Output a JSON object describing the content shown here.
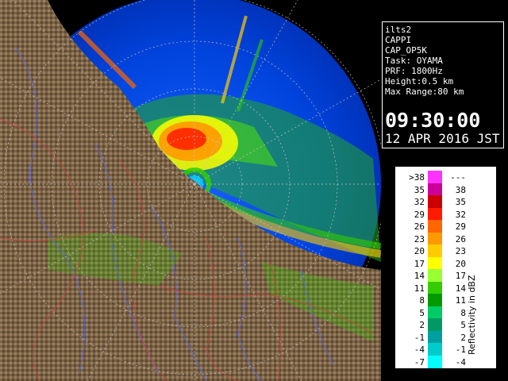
{
  "info": {
    "lines": [
      "ilts2",
      "CAPPI",
      "CAP_OP5K",
      "Task: OYAMA",
      "PRF: 1800Hz",
      "Height:0.5 km",
      "Max Range:80 km"
    ],
    "time": "09:30:00",
    "date": "12 APR 2016 JST"
  },
  "legend": {
    "title": "Reflectivity in dBZ",
    "rows": [
      {
        "low": ">38",
        "high": "---",
        "color": "#ff33ff"
      },
      {
        "low": "35",
        "high": "38",
        "color": "#cc0099"
      },
      {
        "low": "32",
        "high": "35",
        "color": "#cc0000"
      },
      {
        "low": "29",
        "high": "32",
        "color": "#ff1a00"
      },
      {
        "low": "26",
        "high": "29",
        "color": "#ff6600"
      },
      {
        "low": "23",
        "high": "26",
        "color": "#ff9900"
      },
      {
        "low": "20",
        "high": "23",
        "color": "#ffcc00"
      },
      {
        "low": "17",
        "high": "20",
        "color": "#ffff00"
      },
      {
        "low": "14",
        "high": "17",
        "color": "#99ff33"
      },
      {
        "low": "11",
        "high": "14",
        "color": "#33cc00"
      },
      {
        "low": "8",
        "high": "11",
        "color": "#009900"
      },
      {
        "low": "5",
        "high": "8",
        "color": "#00cc66"
      },
      {
        "low": "2",
        "high": "5",
        "color": "#009966"
      },
      {
        "low": "-1",
        "high": "2",
        "color": "#00a0a0"
      },
      {
        "low": "-4",
        "high": "-1",
        "color": "#00cccc"
      },
      {
        "low": "-7",
        "high": "-4",
        "color": "#00ffff"
      }
    ]
  },
  "colors": {
    "terrain": "#7a6245",
    "sea": "#000000",
    "radar_coverage": "#0044dd",
    "panel_border": "#ffffff"
  }
}
